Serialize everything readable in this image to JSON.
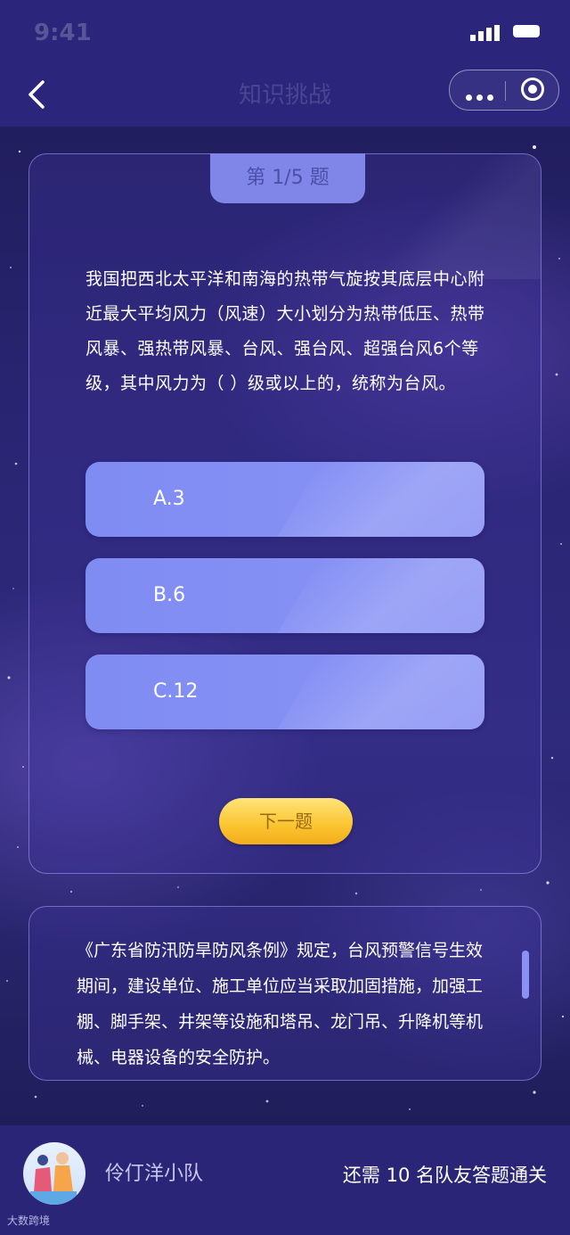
{
  "status_bar": {
    "time": "9:41"
  },
  "nav": {
    "title": "知识挑战"
  },
  "quiz": {
    "progress_label": "第 1/5 题",
    "question": "我国把西北太平洋和南海的热带气旋按其底层中心附近最大平均风力（风速）大小划分为热带低压、热带风暴、强热带风暴、台风、强台风、超强台风6个等级，其中风力为（ ）级或以上的，统称为台风。",
    "options": [
      {
        "label": "A.3"
      },
      {
        "label": "B.6"
      },
      {
        "label": "C.12"
      }
    ],
    "next_label": "下一题"
  },
  "tip": {
    "text": "《广东省防汛防旱防风条例》规定，台风预警信号生效期间，建设单位、施工单位应当采取加固措施，加强工棚、脚手架、井架等设施和塔吊、龙门吊、升降机等机械、电器设备的安全防护。"
  },
  "footer": {
    "team_name": "伶仃洋小队",
    "status": "还需 10 名队友答题通关"
  },
  "watermark": "大数跨境",
  "colors": {
    "nav_bg": "#2b257c",
    "option_bg": "#8a93f5",
    "next_button": "#fbc42f",
    "footer_bg": "#2a2576"
  }
}
